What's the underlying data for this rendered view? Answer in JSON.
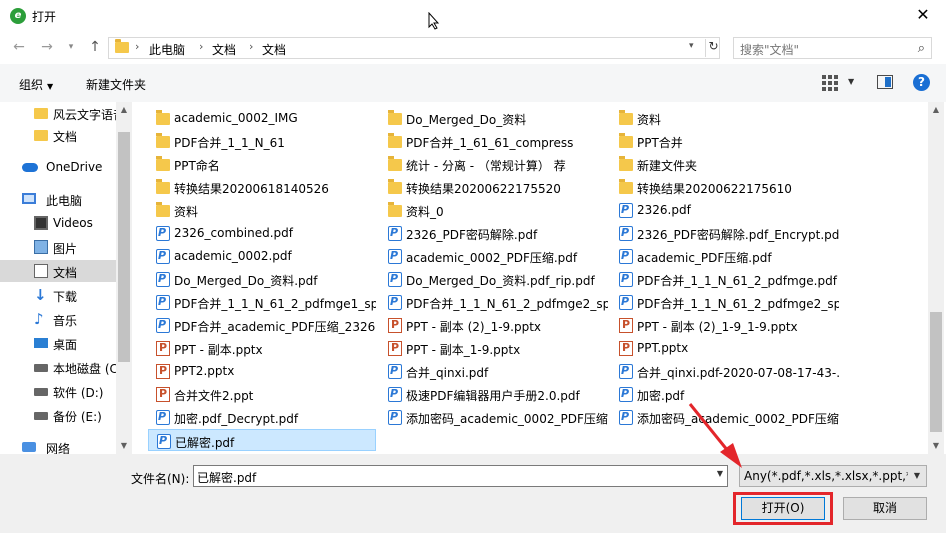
{
  "window": {
    "title": "打开",
    "app_icon_glyph": "e"
  },
  "address": {
    "crumbs": [
      "此电脑",
      "文档",
      "文档"
    ],
    "search_placeholder": "搜索\"文档\""
  },
  "toolbar": {
    "organize": "组织",
    "new_folder": "新建文件夹"
  },
  "nav": {
    "items": [
      {
        "label": "风云文字语音",
        "icon": "folder-icon",
        "indent": 2
      },
      {
        "label": "文档",
        "icon": "folder-icon",
        "indent": 2
      },
      {
        "label": "OneDrive",
        "icon": "cloud-icon",
        "indent": 1
      },
      {
        "label": "此电脑",
        "icon": "computer-icon",
        "indent": 1
      },
      {
        "label": "Videos",
        "icon": "video-icon",
        "indent": 2
      },
      {
        "label": "图片",
        "icon": "picture-icon",
        "indent": 2
      },
      {
        "label": "文档",
        "icon": "document-icon",
        "indent": 2,
        "selected": true
      },
      {
        "label": "下载",
        "icon": "download-icon",
        "indent": 2
      },
      {
        "label": "音乐",
        "icon": "music-icon",
        "indent": 2
      },
      {
        "label": "桌面",
        "icon": "desktop-icon",
        "indent": 2
      },
      {
        "label": "本地磁盘 (C:)",
        "icon": "drive-icon",
        "indent": 2
      },
      {
        "label": "软件 (D:)",
        "icon": "drive-icon",
        "indent": 2
      },
      {
        "label": "备份 (E:)",
        "icon": "drive-icon",
        "indent": 2
      },
      {
        "label": "网络",
        "icon": "network-icon",
        "indent": 1
      }
    ]
  },
  "files": {
    "columns": [
      [
        {
          "name": "academic_0002_IMG",
          "type": "folder"
        },
        {
          "name": "PDF合并_1_1_N_61",
          "type": "folder"
        },
        {
          "name": "PPT命名",
          "type": "folder"
        },
        {
          "name": "转换结果20200618140526",
          "type": "folder"
        },
        {
          "name": "资料",
          "type": "folder"
        },
        {
          "name": "2326_combined.pdf",
          "type": "pdf"
        },
        {
          "name": "academic_0002.pdf",
          "type": "pdf"
        },
        {
          "name": "Do_Merged_Do_资料.pdf",
          "type": "pdf"
        },
        {
          "name": "PDF合并_1_1_N_61_2_pdfmge1_sp...",
          "type": "pdf"
        },
        {
          "name": "PDF合并_academic_PDF压缩_2326...",
          "type": "pdf"
        },
        {
          "name": "PPT - 副本.pptx",
          "type": "ppt"
        },
        {
          "name": "PPT2.pptx",
          "type": "ppt"
        },
        {
          "name": "合并文件2.ppt",
          "type": "ppt"
        },
        {
          "name": "加密.pdf_Decrypt.pdf",
          "type": "pdf"
        },
        {
          "name": "已解密.pdf",
          "type": "pdf",
          "selected": true
        }
      ],
      [
        {
          "name": "Do_Merged_Do_资料",
          "type": "folder"
        },
        {
          "name": "PDF合并_1_61_61_compress",
          "type": "folder"
        },
        {
          "name": "统计 - 分离 - （常规计算） 荐",
          "type": "folder"
        },
        {
          "name": "转换结果20200622175520",
          "type": "folder"
        },
        {
          "name": "资料_0",
          "type": "folder"
        },
        {
          "name": "2326_PDF密码解除.pdf",
          "type": "pdf"
        },
        {
          "name": "academic_0002_PDF压缩.pdf",
          "type": "pdf"
        },
        {
          "name": "Do_Merged_Do_资料.pdf_rip.pdf",
          "type": "pdf"
        },
        {
          "name": "PDF合并_1_1_N_61_2_pdfmge2_sp...",
          "type": "pdf"
        },
        {
          "name": "PPT - 副本 (2)_1-9.pptx",
          "type": "ppt"
        },
        {
          "name": "PPT - 副本_1-9.pptx",
          "type": "ppt"
        },
        {
          "name": "合并_qinxi.pdf",
          "type": "pdf"
        },
        {
          "name": "极速PDF编辑器用户手册2.0.pdf",
          "type": "pdf"
        },
        {
          "name": "添加密码_academic_0002_PDF压缩...",
          "type": "pdf"
        }
      ],
      [
        {
          "name": "资料",
          "type": "folder"
        },
        {
          "name": "PPT合并",
          "type": "folder"
        },
        {
          "name": "新建文件夹",
          "type": "folder"
        },
        {
          "name": "转换结果20200622175610",
          "type": "folder"
        },
        {
          "name": "2326.pdf",
          "type": "pdf"
        },
        {
          "name": "2326_PDF密码解除.pdf_Encrypt.pdf",
          "type": "pdf"
        },
        {
          "name": "academic_PDF压缩.pdf",
          "type": "pdf"
        },
        {
          "name": "PDF合并_1_1_N_61_2_pdfmge.pdf",
          "type": "pdf"
        },
        {
          "name": "PDF合并_1_1_N_61_2_pdfmge2_sp...",
          "type": "pdf"
        },
        {
          "name": "PPT - 副本 (2)_1-9_1-9.pptx",
          "type": "ppt"
        },
        {
          "name": "PPT.pptx",
          "type": "ppt"
        },
        {
          "name": "合并_qinxi.pdf-2020-07-08-17-43-...",
          "type": "pdf"
        },
        {
          "name": "加密.pdf",
          "type": "pdf"
        },
        {
          "name": "添加密码_academic_0002_PDF压缩...",
          "type": "pdf"
        }
      ]
    ]
  },
  "bottom": {
    "filename_label": "文件名(N):",
    "filename_value": "已解密.pdf",
    "filter_value": "Any(*.pdf,*.xls,*.xlsx,*.ppt,*.pptx,*.doc,*.docx)",
    "open_label": "打开(O)",
    "cancel_label": "取消"
  },
  "colors": {
    "accent": "#0078d7",
    "highlight_red": "#e3262b",
    "selection": "#cce8ff"
  }
}
